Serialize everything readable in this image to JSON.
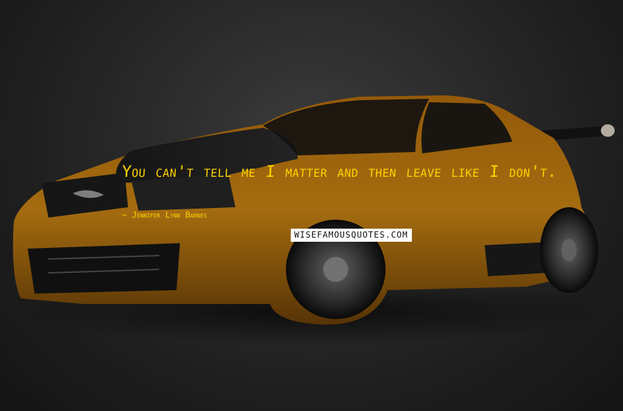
{
  "quote": {
    "text": "You can't tell me I matter and then leave like I don't.",
    "author": "Jennifer Lynn Barnes"
  },
  "watermark": {
    "text": "WISEFAMOUSQUOTES.COM"
  },
  "colors": {
    "quote_text": "#ffd200",
    "car_body": "#c27a10",
    "background": "#2a2a2a"
  }
}
